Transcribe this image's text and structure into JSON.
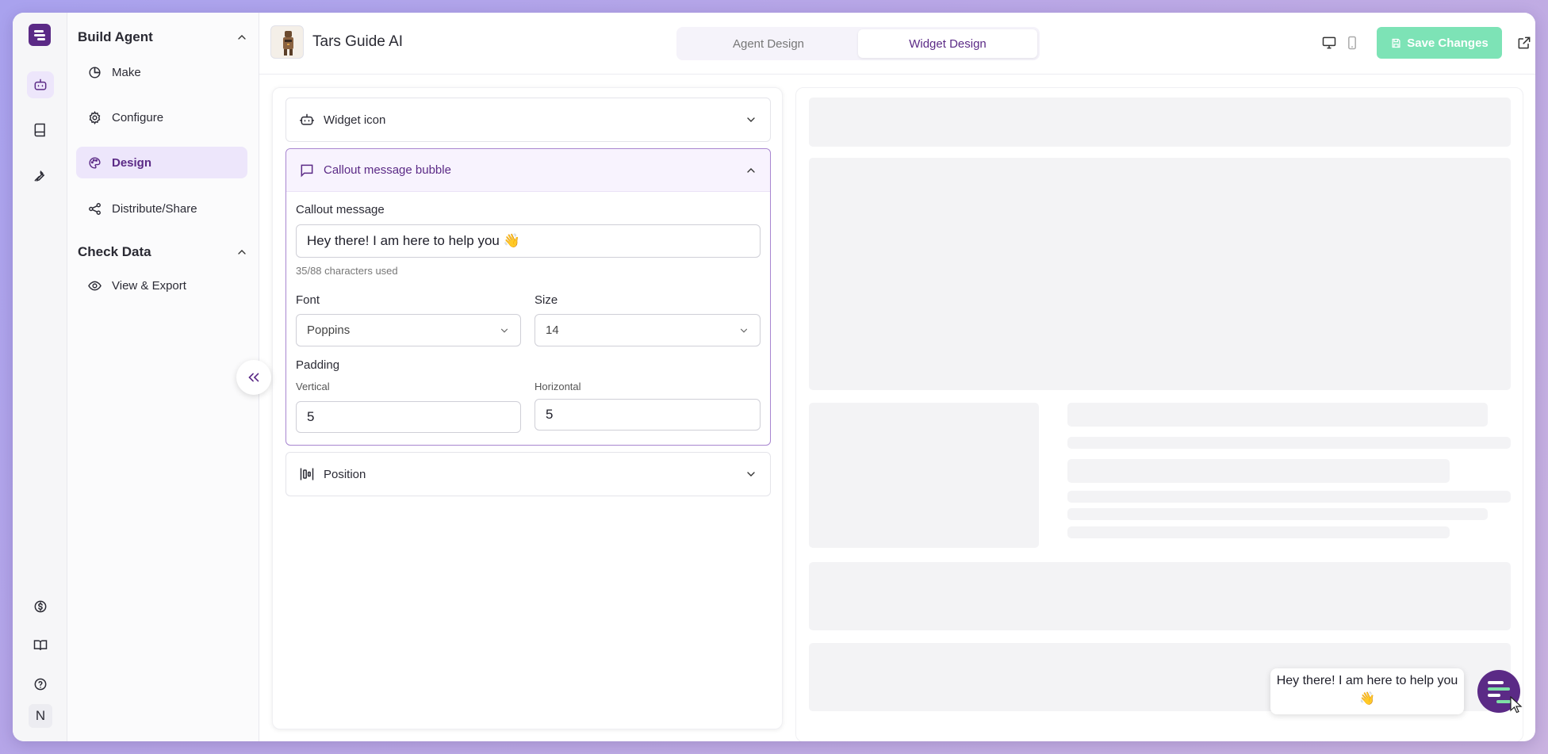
{
  "agent": {
    "name": "Tars Guide AI"
  },
  "tabs": [
    {
      "label": "Agent Design",
      "active": false
    },
    {
      "label": "Widget Design",
      "active": true
    }
  ],
  "toolbar": {
    "save_label": "Save Changes"
  },
  "sidebar": {
    "sections": [
      {
        "title": "Build Agent",
        "items": [
          "Make",
          "Configure",
          "Design",
          "Distribute/Share"
        ]
      },
      {
        "title": "Check Data",
        "items": [
          "View & Export"
        ]
      }
    ],
    "active_item": "Design"
  },
  "rail": {
    "avatar_letter": "N"
  },
  "panel": {
    "widget_icon": {
      "title": "Widget icon"
    },
    "callout": {
      "title": "Callout message bubble",
      "message_label": "Callout message",
      "message_value": "Hey there! I am here to help you 👋",
      "char_count": "35/88 characters used",
      "font_label": "Font",
      "font_value": "Poppins",
      "size_label": "Size",
      "size_value": "14",
      "padding_label": "Padding",
      "vertical_label": "Vertical",
      "vertical_value": "5",
      "horizontal_label": "Horizontal",
      "horizontal_value": "5"
    },
    "position": {
      "title": "Position"
    }
  },
  "preview": {
    "bubble_text": "Hey there! I am here to help you 👋"
  },
  "colors": {
    "brand": "#5b2a86",
    "save": "#7de3b6",
    "active_bg": "#ede6fb",
    "skeleton": "#f3f3f5"
  }
}
